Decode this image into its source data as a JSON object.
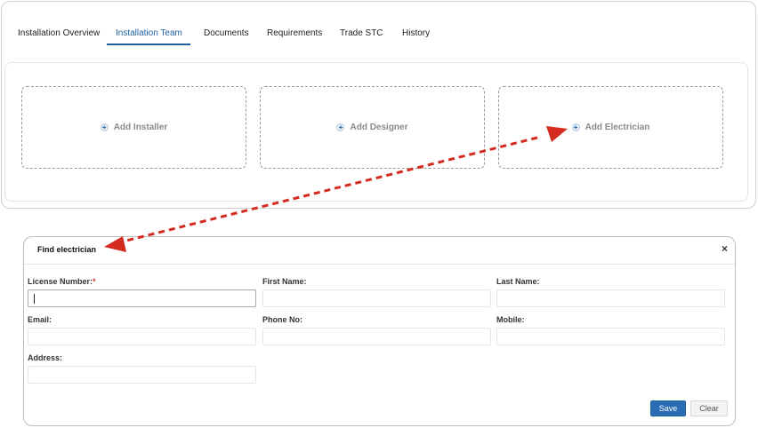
{
  "tabs": [
    {
      "label": "Installation Overview",
      "active": false
    },
    {
      "label": "Installation Team",
      "active": true
    },
    {
      "label": "Documents",
      "active": false
    },
    {
      "label": "Requirements",
      "active": false
    },
    {
      "label": "Trade STC",
      "active": false
    },
    {
      "label": "History",
      "active": false
    }
  ],
  "add_cards": [
    {
      "label": "Add Installer",
      "icon": "plus-circle-icon"
    },
    {
      "label": "Add Designer",
      "icon": "plus-circle-icon"
    },
    {
      "label": "Add Electrician",
      "icon": "plus-circle-icon"
    }
  ],
  "modal": {
    "title": "Find electrician",
    "close_glyph": "×",
    "fields": {
      "license": {
        "label": "License Number:",
        "required_mark": "*",
        "value": ""
      },
      "first_name": {
        "label": "First Name:",
        "value": ""
      },
      "last_name": {
        "label": "Last Name:",
        "value": ""
      },
      "email": {
        "label": "Email:",
        "value": ""
      },
      "phone": {
        "label": "Phone No:",
        "value": ""
      },
      "mobile": {
        "label": "Mobile:",
        "value": ""
      },
      "address": {
        "label": "Address:",
        "value": ""
      }
    },
    "save_label": "Save",
    "clear_label": "Clear"
  },
  "colors": {
    "accent": "#1f5fa0",
    "arrow": "#d42a1f",
    "save_button": "#2a6db5"
  }
}
